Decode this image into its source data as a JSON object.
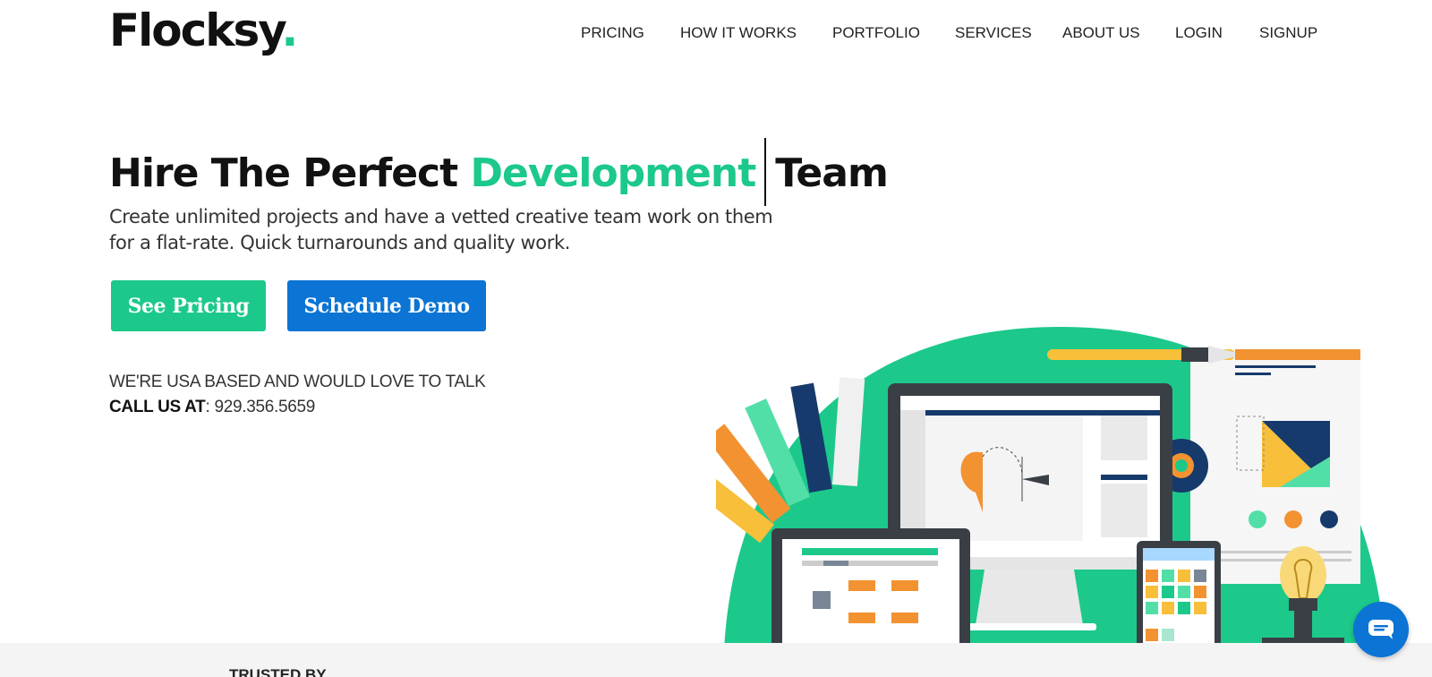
{
  "brand": {
    "name": "Flocksy",
    "dot": ".",
    "accent_color": "#1cc98b",
    "blue_color": "#0b74d4"
  },
  "nav": {
    "items": [
      {
        "label": "PRICING"
      },
      {
        "label": "HOW IT WORKS"
      },
      {
        "label": "PORTFOLIO"
      },
      {
        "label": "SERVICES"
      },
      {
        "label": "ABOUT US"
      },
      {
        "label": "LOGIN"
      },
      {
        "label": "SIGNUP"
      }
    ]
  },
  "hero": {
    "title_before": "Hire The Perfect ",
    "title_accent": "Development",
    "title_after": "Team",
    "subtitle_line1": "Create unlimited projects and have a vetted creative team work on them",
    "subtitle_line2": "for a flat-rate. Quick turnarounds and quality work.",
    "primary_button": "See Pricing",
    "secondary_button": "Schedule Demo",
    "contact_line": "WE'RE USA BASED AND WOULD LOVE TO TALK",
    "call_label": "CALL US AT",
    "phone": ": 929.356.5659"
  },
  "trusted": {
    "label": "TRUSTED BY"
  },
  "chat": {
    "icon": "chat-icon"
  }
}
